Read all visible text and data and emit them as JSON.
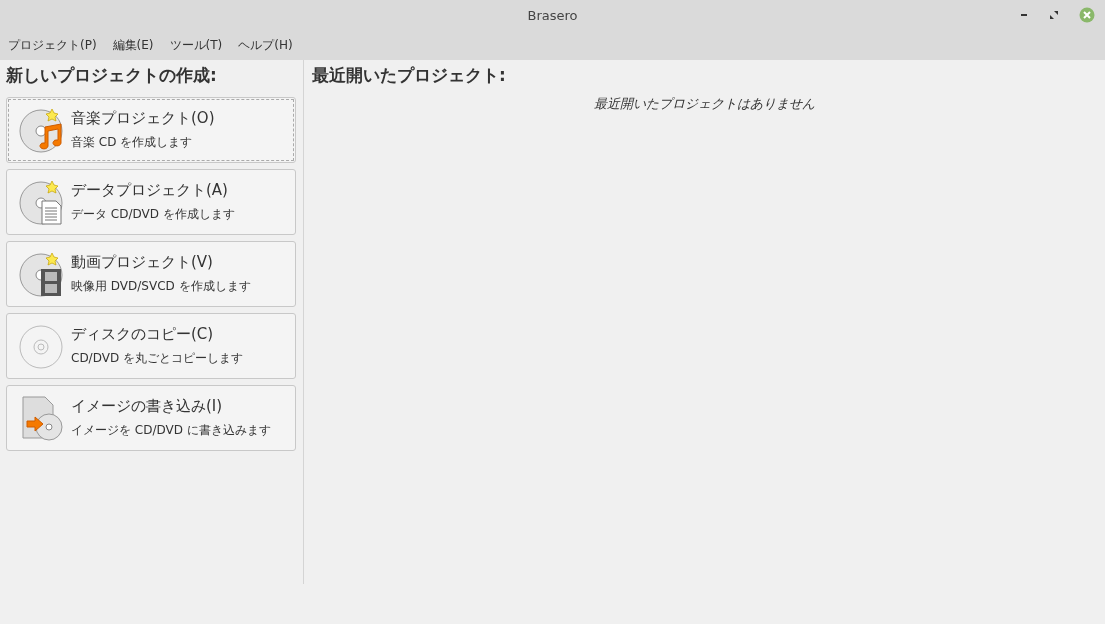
{
  "window": {
    "title": "Brasero"
  },
  "menu": [
    "プロジェクト(P)",
    "編集(E)",
    "ツール(T)",
    "ヘルプ(H)"
  ],
  "new_project": {
    "heading": "新しいプロジェクトの作成:",
    "items": [
      {
        "kind": "music",
        "title": "音楽プロジェクト(O)",
        "description": "音楽 CD を作成します",
        "selected": true
      },
      {
        "kind": "data",
        "title": "データプロジェクト(A)",
        "description": "データ CD/DVD を作成します",
        "selected": false
      },
      {
        "kind": "video",
        "title": "動画プロジェクト(V)",
        "description": "映像用 DVD/SVCD を作成します",
        "selected": false
      },
      {
        "kind": "copy",
        "title": "ディスクのコピー(C)",
        "description": "CD/DVD を丸ごとコピーします",
        "selected": false
      },
      {
        "kind": "image",
        "title": "イメージの書き込み(I)",
        "description": "イメージを CD/DVD に書き込みます",
        "selected": false
      }
    ]
  },
  "recent": {
    "heading": "最近開いたプロジェクト:",
    "empty_message": "最近開いたプロジェクトはありません"
  }
}
